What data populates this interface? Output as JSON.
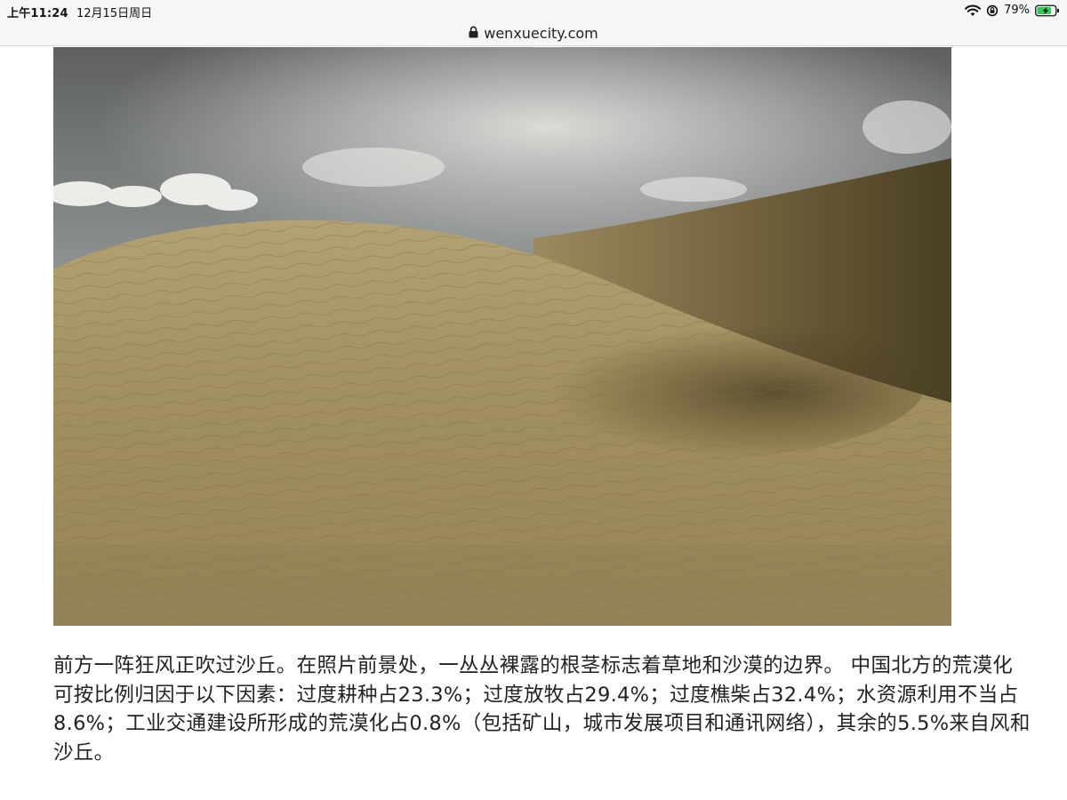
{
  "status_bar": {
    "time": "上午11:24",
    "date": "12月15日周日",
    "battery_percent": "79%",
    "battery_level": 0.79,
    "icons": [
      "wifi-icon",
      "rotation-lock-icon",
      "battery-charging-icon"
    ]
  },
  "browser": {
    "url": "wenxuecity.com",
    "icons": [
      "lock-icon"
    ]
  },
  "article": {
    "image": {
      "subject": "sand-dunes-photo"
    },
    "paragraph": "前方一阵狂风正吹过沙丘。在照片前景处，一丛丛裸露的根茎标志着草地和沙漠的边界。 中国北方的荒漠化可按比例归因于以下因素：过度耕种占23.3%；过度放牧占29.4%；过度樵柴占32.4%；水资源利用不当占8.6%；工业交通建设所形成的荒漠化占0.8%（包括矿山，城市发展项目和通讯网络），其余的5.5%来自风和沙丘。"
  },
  "colors": {
    "chrome_bg": "#f6f6f6",
    "battery_green": "#34c759",
    "text": "#222222"
  }
}
